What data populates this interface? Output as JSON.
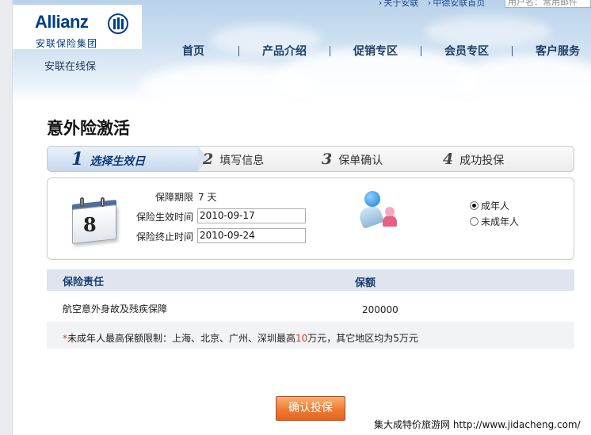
{
  "header": {
    "logo_word": "Allianz",
    "logo_cn": "安联保险集团",
    "logo_sub": "安联在线保",
    "top_links": [
      "关于安联",
      "中德安联首页"
    ],
    "user_field_placeholder": "用户名：常用邮件",
    "nav": [
      "首页",
      "产品介绍",
      "促销专区",
      "会员专区",
      "客户服务"
    ]
  },
  "page_title": "意外险激活",
  "steps": [
    {
      "num": "1",
      "label": "选择生效日",
      "active": true
    },
    {
      "num": "2",
      "label": "填写信息",
      "active": false
    },
    {
      "num": "3",
      "label": "保单确认",
      "active": false
    },
    {
      "num": "4",
      "label": "成功投保",
      "active": false
    }
  ],
  "form": {
    "calendar_day": "8",
    "period_label": "保障期限",
    "period_value": "7 天",
    "start_label": "保险生效时间",
    "start_value": "2010-09-17",
    "end_label": "保险终止时间",
    "end_value": "2010-09-24",
    "radios": [
      {
        "label": "成年人",
        "checked": true
      },
      {
        "label": "未成年人",
        "checked": false
      }
    ]
  },
  "coverage": {
    "col_responsibility": "保险责任",
    "col_amount": "保额",
    "row_item": "航空意外身故及残疾保障",
    "row_amount": "200000",
    "note_star": "*",
    "note_a": "未成年人最高保额限制：上海、北京、广州、深圳最高",
    "note_num": "10",
    "note_b": "万元，其它地区均为5万元"
  },
  "confirm_label": "确认投保",
  "watermark": "集大成特价旅游网 http://www.jidacheng.com/",
  "colors": {
    "brand": "#003d84",
    "accent": "#f07a32"
  }
}
